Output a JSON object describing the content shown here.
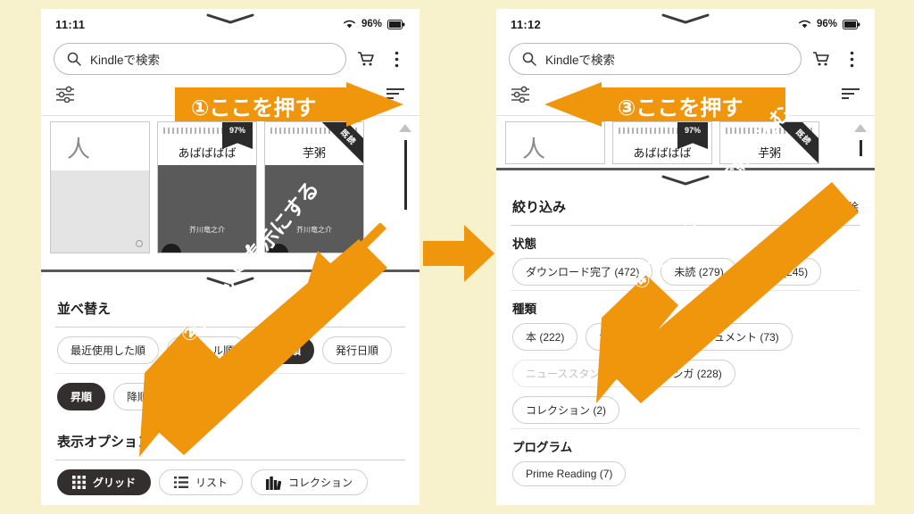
{
  "theme": {
    "background": "#F7F2CB",
    "accent_orange": "#F0960D",
    "selected_chip": "#332F2F",
    "phone_bg": "#FFFFFF"
  },
  "left_phone": {
    "status": {
      "time": "11:11",
      "battery_pct": "96%",
      "wifi_icon": "wifi-icon",
      "battery_icon": "battery-icon"
    },
    "search": {
      "placeholder": "Kindleで検索",
      "icon": "search-icon"
    },
    "toolbar": {
      "cart_icon": "cart-icon",
      "overflow_icon": "overflow-menu-icon",
      "filter_icon": "filter-settings-icon",
      "sort_icon": "sort-icon"
    },
    "shelf": {
      "books": [
        {
          "type": "pdf",
          "title": "",
          "author": "",
          "badge": "",
          "ribbon": ""
        },
        {
          "type": "cover",
          "title": "あばばばば",
          "author": "芥川竜之介",
          "badge": "97%",
          "ribbon": ""
        },
        {
          "type": "cover",
          "title": "芋粥",
          "author": "芥川竜之介",
          "badge": "",
          "ribbon": "既読"
        }
      ]
    },
    "sheet": {
      "sort_title": "並べ替え",
      "sort_options": [
        {
          "label": "最近使用した順",
          "selected": false
        },
        {
          "label": "タイトル順",
          "selected": false
        },
        {
          "label": "著者順",
          "selected": true
        },
        {
          "label": "発行日順",
          "selected": false
        }
      ],
      "order_options": [
        {
          "label": "昇順",
          "selected": true
        },
        {
          "label": "降順",
          "selected": false
        }
      ],
      "display_title": "表示オプション",
      "display_options": [
        {
          "label": "グリッド",
          "icon": "grid-icon",
          "selected": true
        },
        {
          "label": "リスト",
          "icon": "list-icon",
          "selected": false
        },
        {
          "label": "コレクション",
          "icon": "collection-icon",
          "selected": false
        }
      ]
    }
  },
  "right_phone": {
    "status": {
      "time": "11:12",
      "battery_pct": "96%",
      "wifi_icon": "wifi-icon",
      "battery_icon": "battery-icon"
    },
    "search": {
      "placeholder": "Kindleで検索",
      "icon": "search-icon"
    },
    "toolbar": {
      "cart_icon": "cart-icon",
      "overflow_icon": "overflow-menu-icon",
      "filter_icon": "filter-settings-icon",
      "sort_icon": "sort-icon"
    },
    "shelf": {
      "books": [
        {
          "type": "pdf",
          "title": "",
          "author": "",
          "badge": "",
          "ribbon": ""
        },
        {
          "type": "cover",
          "title": "あばばばば",
          "author": "",
          "badge": "97%",
          "ribbon": ""
        },
        {
          "type": "cover",
          "title": "芋粥",
          "author": "",
          "badge": "",
          "ribbon": "既読"
        }
      ]
    },
    "sheet": {
      "filter_title": "絞り込み",
      "clear_label": "解除",
      "groups": [
        {
          "label": "状態",
          "chips": [
            {
              "label": "ダウンロード完了 (472)",
              "dim": false
            },
            {
              "label": "未読 (279)",
              "dim": false
            },
            {
              "label": "既読 (245)",
              "dim": false
            }
          ]
        },
        {
          "label": "種類",
          "chips": [
            {
              "label": "本 (222)",
              "dim": false
            },
            {
              "label": "サンプル (1)",
              "dim": false
            },
            {
              "label": "ドキュメント (73)",
              "dim": false
            },
            {
              "label": "ニューススタンド (0)",
              "dim": true
            },
            {
              "label": "マンガ (228)",
              "dim": false
            },
            {
              "label": "コレクション (2)",
              "dim": false
            }
          ]
        },
        {
          "label": "プログラム",
          "chips": [
            {
              "label": "Prime Reading (7)",
              "dim": false
            }
          ]
        }
      ]
    }
  },
  "annotations": {
    "step1": "①ここを押す",
    "step2": "②グリッド表示にする",
    "step3": "③ここを押す",
    "step4": "④コレクションで絞り込む",
    "transition_icon": "right-arrow-icon"
  }
}
